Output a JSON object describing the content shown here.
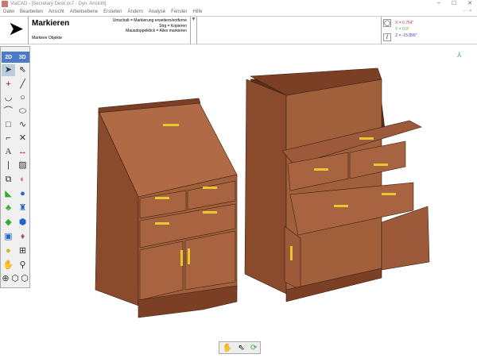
{
  "window": {
    "title": "ViaCAD - [Secretary Desk.vc7 - Dyn. Ansicht]",
    "controls": [
      "–",
      "☐",
      "✕"
    ]
  },
  "menu": [
    "Datei",
    "Bearbeiten",
    "Ansicht",
    "Arbeitsebene",
    "Erstellen",
    "Ändern",
    "Analyse",
    "Fenster",
    "Hilfe"
  ],
  "command": {
    "title": "Markieren",
    "subtitle": "Markiere Objekte",
    "hints": [
      "Umschalt = Markierung erweitern/entferne",
      "Strg = Kopieren",
      "Mausdoppelklick = Alles markieren"
    ]
  },
  "coords": {
    "x": "X = 0.754\"",
    "y": "Y = 0.0\"",
    "z": "Z = -15.899\""
  },
  "view_tabs": [
    "2D",
    "3D"
  ],
  "colors": {
    "wood": "#9c5a3a",
    "accent": "#4a7ac8"
  }
}
